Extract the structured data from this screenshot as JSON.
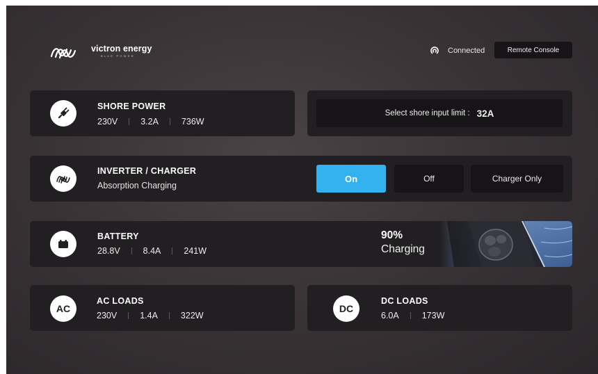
{
  "header": {
    "brand_name": "victron energy",
    "brand_tagline": "BLUE POWER",
    "connection_status": "Connected",
    "remote_console_label": "Remote Console"
  },
  "shore_power": {
    "title": "SHORE POWER",
    "voltage": "230V",
    "current": "3.2A",
    "power": "736W",
    "limit_label": "Select shore input limit :",
    "limit_value": "32A"
  },
  "inverter": {
    "title": "INVERTER / CHARGER",
    "state": "Absorption Charging",
    "modes": [
      {
        "label": "On",
        "active": true
      },
      {
        "label": "Off",
        "active": false
      },
      {
        "label": "Charger Only",
        "active": false
      }
    ]
  },
  "battery": {
    "title": "BATTERY",
    "voltage": "28.8V",
    "current": "8.4A",
    "power": "241W",
    "soc": "90%",
    "state": "Charging"
  },
  "ac_loads": {
    "title": "AC LOADS",
    "icon_text": "AC",
    "voltage": "230V",
    "current": "1.4A",
    "power": "322W"
  },
  "dc_loads": {
    "title": "DC LOADS",
    "icon_text": "DC",
    "current": "6.0A",
    "power": "173W"
  },
  "colors": {
    "accent": "#33b2ef",
    "card": "#221f22",
    "button": "#161416"
  }
}
